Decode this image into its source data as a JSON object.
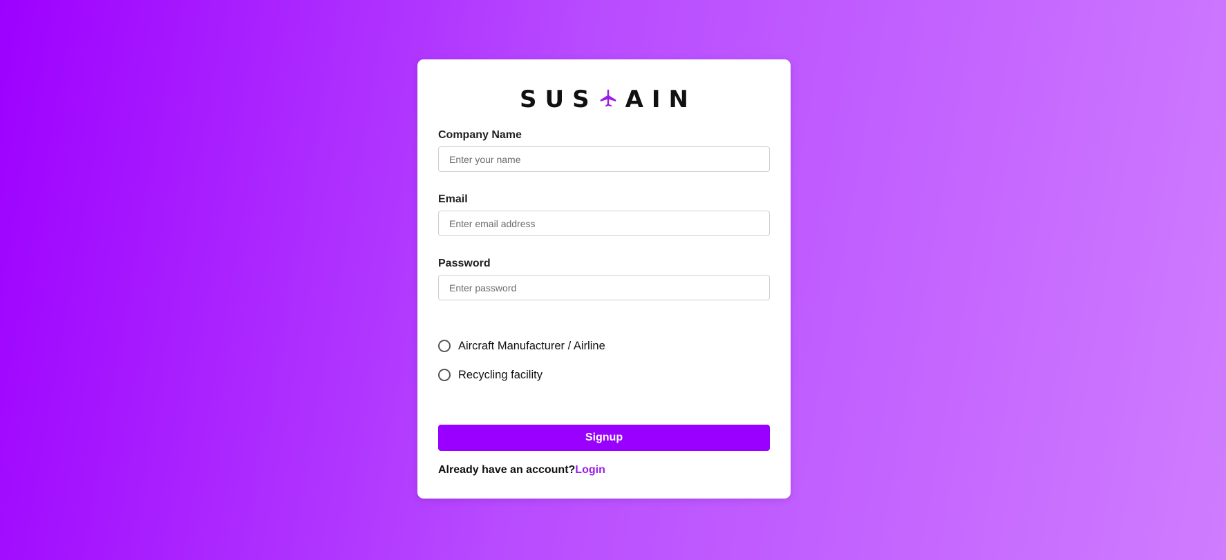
{
  "brand": {
    "part_left": "SUS",
    "part_right": "AIN",
    "icon": "airplane-icon",
    "icon_color": "#9b1ee6"
  },
  "form": {
    "company": {
      "label": "Company Name",
      "placeholder": "Enter your name",
      "value": ""
    },
    "email": {
      "label": "Email",
      "placeholder": "Enter email address",
      "value": ""
    },
    "password": {
      "label": "Password",
      "placeholder": "Enter password",
      "value": ""
    },
    "roles": [
      {
        "label": "Aircraft Manufacturer / Airline",
        "selected": false
      },
      {
        "label": "Recycling facility",
        "selected": false
      }
    ],
    "submit_label": "Signup"
  },
  "footer": {
    "prompt": "Already have an account?",
    "link_label": "Login"
  },
  "colors": {
    "accent": "#9900ff",
    "link": "#9b1ee6",
    "background_start": "#9d00ff",
    "background_end": "#cf7cff"
  }
}
